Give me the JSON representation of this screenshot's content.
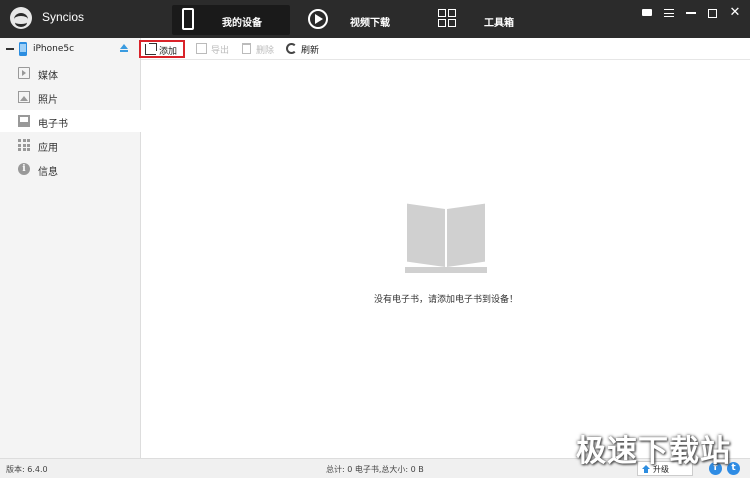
{
  "app": {
    "title": "Syncios"
  },
  "nav": {
    "tabs": [
      {
        "label": "我的设备",
        "icon": "phone-icon",
        "active": true
      },
      {
        "label": "视频下载",
        "icon": "play-icon",
        "active": false
      },
      {
        "label": "工具箱",
        "icon": "toolbox-icon",
        "active": false
      }
    ]
  },
  "window_controls": [
    "chat-icon",
    "menu-icon",
    "minimize-icon",
    "maximize-icon",
    "close-icon"
  ],
  "window_close_glyph": "✕",
  "device": {
    "name": "iPhone5c"
  },
  "sidebar": {
    "items": [
      {
        "label": "媒体",
        "icon": "media-icon"
      },
      {
        "label": "照片",
        "icon": "photo-icon"
      },
      {
        "label": "电子书",
        "icon": "ebook-icon",
        "active": true
      },
      {
        "label": "应用",
        "icon": "apps-icon"
      },
      {
        "label": "信息",
        "icon": "info-icon"
      }
    ]
  },
  "info_glyph": "i",
  "toolbar": {
    "add_label": "添加",
    "export_label": "导出",
    "delete_label": "删除",
    "refresh_label": "刷新"
  },
  "main": {
    "empty_message": "没有电子书，请添加电子书到设备！"
  },
  "status": {
    "version": "版本: 6.4.0",
    "summary": "总计: 0 电子书,总大小: 0 B",
    "upgrade_label": "升级",
    "facebook_glyph": "f",
    "twitter_glyph": "t"
  },
  "watermark": "极速下载站",
  "colors": {
    "titlebar": "#2b2b2b",
    "accent": "#2d8de0",
    "highlight_border": "#d9232a",
    "sidebar_bg": "#f4f4f4"
  }
}
